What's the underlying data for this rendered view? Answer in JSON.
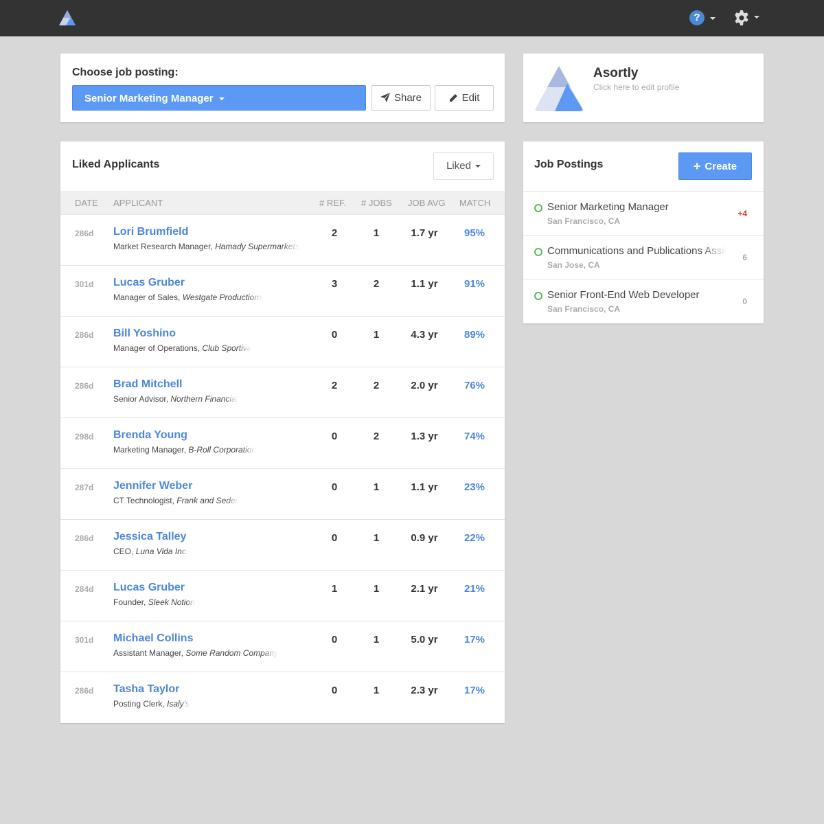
{
  "topbar": {
    "logo_icon": "asortly-logo-icon",
    "help_icon": "question-bubble-icon",
    "help_label": "?",
    "settings_icon": "gear-icon"
  },
  "choose": {
    "label": "Choose job posting:",
    "selected_job": "Senior Marketing Manager",
    "share_label": "Share",
    "edit_label": "Edit"
  },
  "profile": {
    "company": "Asortly",
    "edit_hint": "Click here to edit profile"
  },
  "applicants": {
    "title": "Liked Applicants",
    "filter_label": "Liked",
    "columns": {
      "date": "DATE",
      "applicant": "APPLICANT",
      "ref": "# REF.",
      "jobs": "# JOBS",
      "avg": "JOB AVG",
      "match": "MATCH"
    },
    "rows": [
      {
        "date": "286d",
        "name": "Lori Brumfield",
        "title": "Market Research Manager,",
        "company": "Hamady Supermarkets",
        "ref": "2",
        "jobs": "1",
        "avg": "1.7 yr",
        "match": "95%"
      },
      {
        "date": "301d",
        "name": "Lucas Gruber",
        "title": "Manager of Sales,",
        "company": "Westgate Productions",
        "ref": "3",
        "jobs": "2",
        "avg": "1.1 yr",
        "match": "91%"
      },
      {
        "date": "286d",
        "name": "Bill Yoshino",
        "title": "Manager of Operations,",
        "company": "Club Sportiva",
        "ref": "0",
        "jobs": "1",
        "avg": "4.3 yr",
        "match": "89%"
      },
      {
        "date": "286d",
        "name": "Brad Mitchell",
        "title": "Senior Advisor,",
        "company": "Northern Financial",
        "ref": "2",
        "jobs": "2",
        "avg": "2.0 yr",
        "match": "76%"
      },
      {
        "date": "298d",
        "name": "Brenda Young",
        "title": "Marketing Manager,",
        "company": "B-Roll Corporation",
        "ref": "0",
        "jobs": "2",
        "avg": "1.3 yr",
        "match": "74%"
      },
      {
        "date": "287d",
        "name": "Jennifer Weber",
        "title": "CT Technologist,",
        "company": "Frank and Seder",
        "ref": "0",
        "jobs": "1",
        "avg": "1.1 yr",
        "match": "23%"
      },
      {
        "date": "286d",
        "name": "Jessica Talley",
        "title": "CEO,",
        "company": "Luna Vida Inc.",
        "ref": "0",
        "jobs": "1",
        "avg": "0.9 yr",
        "match": "22%"
      },
      {
        "date": "284d",
        "name": "Lucas Gruber",
        "title": "Founder,",
        "company": "Sleek Notion",
        "ref": "1",
        "jobs": "1",
        "avg": "2.1 yr",
        "match": "21%"
      },
      {
        "date": "301d",
        "name": "Michael Collins",
        "title": "Assistant Manager,",
        "company": "Some Random Company",
        "ref": "0",
        "jobs": "1",
        "avg": "5.0 yr",
        "match": "17%"
      },
      {
        "date": "286d",
        "name": "Tasha Taylor",
        "title": "Posting Clerk,",
        "company": "Isaly's",
        "ref": "0",
        "jobs": "1",
        "avg": "2.3 yr",
        "match": "17%"
      }
    ]
  },
  "postings": {
    "title": "Job Postings",
    "create_label": "Create",
    "items": [
      {
        "name": "Senior Marketing Manager",
        "location": "San Francisco, CA",
        "count": "+4",
        "status_color": "#5cb85c"
      },
      {
        "name": "Communications and Publications Assistant",
        "location": "San Jose, CA",
        "count": "6",
        "status_color": "#5cb85c"
      },
      {
        "name": "Senior Front-End Web Developer",
        "location": "San Francisco, CA",
        "count": "0",
        "status_color": "#5cb85c"
      }
    ]
  },
  "colors": {
    "accent": "#5b99f4",
    "link": "#4a86dc",
    "topbar": "#333333",
    "background": "#d8d8d8",
    "new_count": "#d9363e"
  }
}
